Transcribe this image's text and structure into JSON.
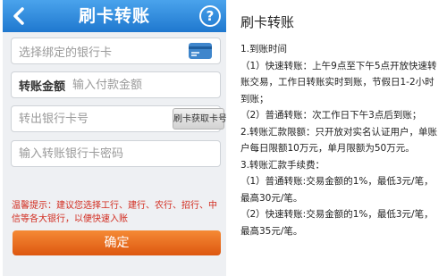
{
  "phone": {
    "header": {
      "title": "刷卡转账",
      "help_label": "?"
    },
    "fields": {
      "bound_card": {
        "text": "选择绑定的银行卡"
      },
      "amount": {
        "label": "转账金额",
        "placeholder": "输入付款金额"
      },
      "card_number": {
        "placeholder": "转出银行卡号",
        "swipe_label": "刷卡获取卡号"
      },
      "password": {
        "placeholder": "输入转账银行卡密码"
      }
    },
    "warm_tip": "温馨提示：建议您选择工行、建行、农行、招行、中信等各大银行，以便快速入账",
    "confirm_label": "确定",
    "colors": {
      "header": "#2a86d8",
      "confirm": "#e8661e",
      "tip": "#d22b1f",
      "card_icon": "#3f86cc"
    }
  },
  "article": {
    "title": "刷卡转账",
    "lines": [
      "1.到账时间",
      "（1）快速转账：上午9点至下午5点开放快速转账交易，工作日转账实时到账，节假日1-2小时到账；",
      "（2）普通转账：次工作日下午3点后到账；",
      "2.转账汇款限额：只开放对实名认证用户，单账户每日限额10万元，单月限额为50万元。",
      "3.转账汇款手续费：",
      "（1）普通转账:交易金额的1%，最低3元/笔，最高30元/笔。",
      "（2）快速转账:交易金额的1%，最低3元/笔，最高35元/笔。"
    ]
  }
}
